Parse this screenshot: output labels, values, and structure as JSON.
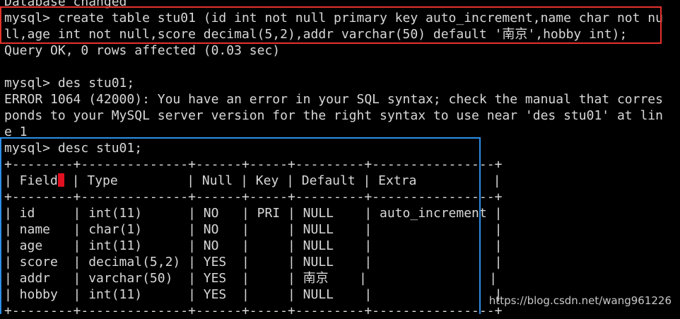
{
  "terminal": {
    "lines": [
      "Database changed",
      "mysql> create table stu01 (id int not null primary key auto_increment,name char not nu",
      "ll,age int not null,score decimal(5,2),addr varchar(50) default '南京',hobby int);",
      "Query OK, 0 rows affected (0.03 sec)",
      "",
      "mysql> des stu01;",
      "ERROR 1064 (42000): You have an error in your SQL syntax; check the manual that corres",
      "ponds to your MySQL server version for the right syntax to use near 'des stu01' at lin",
      "e 1",
      "mysql> desc stu01;",
      "+--------+--------------+------+-----+---------+----------------+",
      "| Field",
      "+--------+--------------+------+-----+---------+----------------+",
      "| id     | int(11)      | NO   | PRI | NULL    | auto_increment |",
      "| name   | char(1)      | NO   |     | NULL    |                |",
      "| age    | int(11)      | NO   |     | NULL    |                |",
      "| score  | decimal(5,2) | YES  |     | NULL    |                |",
      "| addr   | varchar(50)  | YES  |     | 南京    |                |",
      "| hobby  | int(11)      | YES  |     | NULL    |                |",
      "+--------+--------------+------+-----+---------+----------------+"
    ],
    "header_row_rest": " | Type         | Null | Key | Default | Extra          |"
  },
  "watermark": "https://blog.csdn.net/wang961226",
  "colors": {
    "background": "#000000",
    "text": "#d8d8d8",
    "red_box": "#e5322d",
    "blue_box": "#2e8fe8",
    "cursor": "#e01020"
  }
}
